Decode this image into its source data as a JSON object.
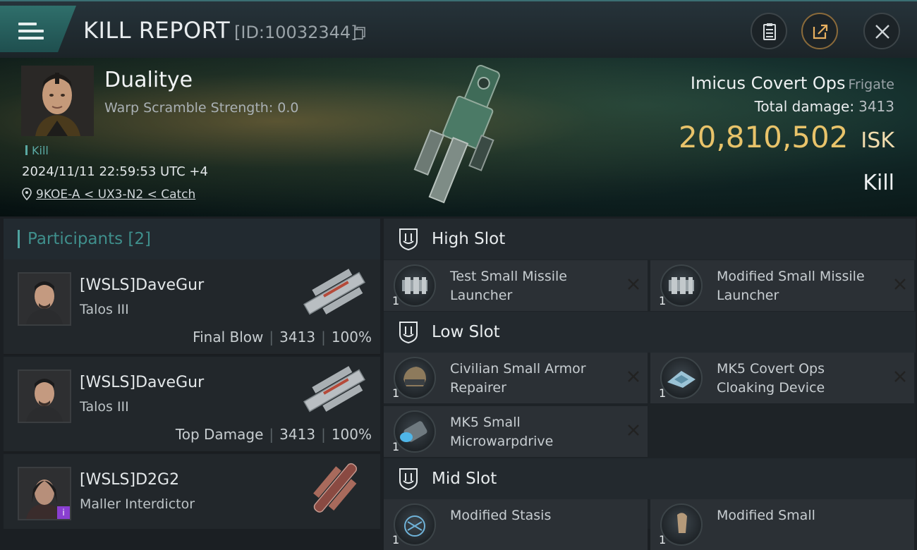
{
  "header": {
    "title": "KILL REPORT",
    "report_id": "[ID:10032344]"
  },
  "victim": {
    "name": "Dualitye",
    "warp_scramble": "Warp Scramble Strength: 0.0",
    "tag": "Kill",
    "datetime": "2024/11/11 22:59:53 UTC +4",
    "location": "9KOE-A < UX3-N2 < Catch",
    "ship_name": "Imicus Covert Ops",
    "ship_class": "Frigate",
    "total_damage_label": "Total damage:",
    "total_damage": "3413",
    "isk_value": "20,810,502",
    "isk_unit": "ISK",
    "result": "Kill"
  },
  "participants": {
    "label": "Participants [2]",
    "items": [
      {
        "name": "[WSLS]DaveGur",
        "ship": "Talos III",
        "role": "Final Blow",
        "damage": "3413",
        "percent": "100%"
      },
      {
        "name": "[WSLS]DaveGur",
        "ship": "Talos III",
        "role": "Top Damage",
        "damage": "3413",
        "percent": "100%"
      },
      {
        "name": "[WSLS]D2G2",
        "ship": "Maller Interdictor",
        "badge": "i"
      }
    ]
  },
  "slots": {
    "high": {
      "label": "High Slot",
      "items": [
        {
          "qty": "1",
          "name": "Test Small Missile Launcher"
        },
        {
          "qty": "1",
          "name": "Modified Small Missile Launcher"
        }
      ]
    },
    "low": {
      "label": "Low Slot",
      "items": [
        {
          "qty": "1",
          "name": "Civilian Small Armor Repairer"
        },
        {
          "qty": "1",
          "name": "MK5 Covert Ops Cloaking Device"
        },
        {
          "qty": "1",
          "name": "MK5 Small Microwarpdrive"
        }
      ]
    },
    "mid": {
      "label": "Mid Slot",
      "items": [
        {
          "qty": "1",
          "name": "Modified Stasis"
        },
        {
          "qty": "1",
          "name": "Modified Small"
        }
      ]
    }
  },
  "colors": {
    "accent": "#4fa3a0",
    "isk": "#e8c36a"
  }
}
